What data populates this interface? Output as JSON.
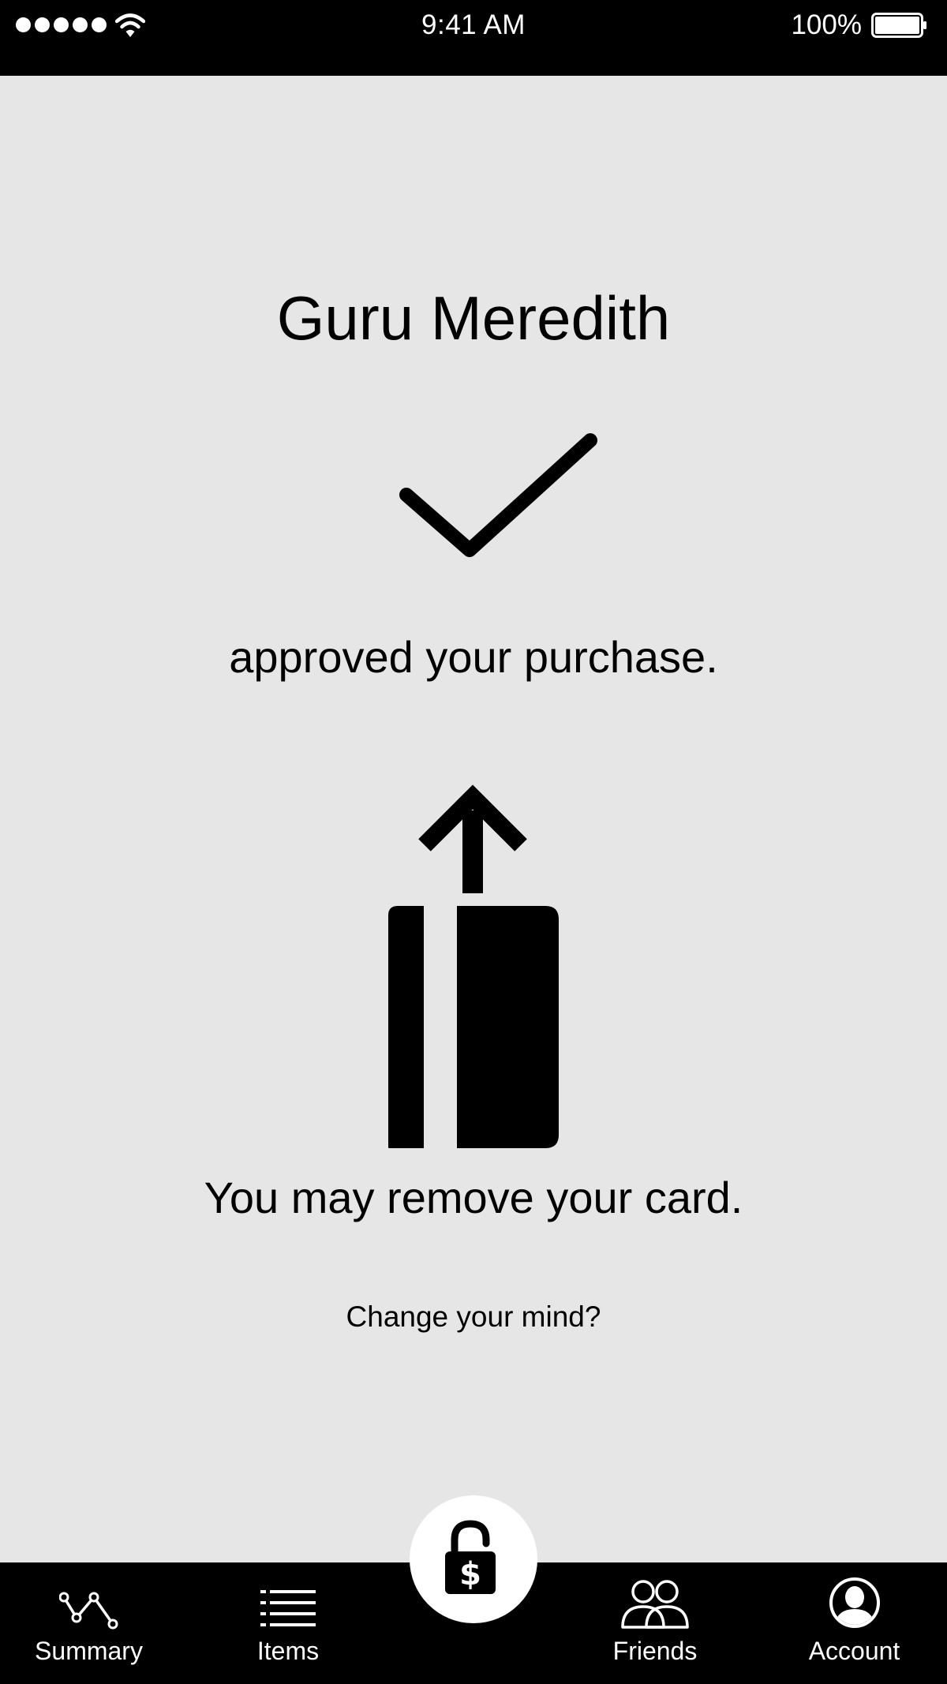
{
  "status_bar": {
    "time": "9:41 AM",
    "battery_percent": "100%",
    "signal_bars": 5,
    "signal_icon": "cellular-signal-dots",
    "wifi_icon": "wifi-icon",
    "battery_icon": "battery-full-icon"
  },
  "main": {
    "approver_name": "Guru Meredith",
    "approved_message": "approved your purchase.",
    "status_icon": "checkmark-icon",
    "card_icon": "remove-card-icon",
    "remove_card_message": "You may remove your card.",
    "change_mind_link": "Change your mind?"
  },
  "tab_bar": {
    "center_button_icon": "unlocked-padlock-dollar-icon",
    "tabs": [
      {
        "label": "Summary",
        "icon": "trend-line-icon"
      },
      {
        "label": "Items",
        "icon": "list-icon"
      },
      {
        "label": "Friends",
        "icon": "friends-icon"
      },
      {
        "label": "Account",
        "icon": "account-icon"
      }
    ]
  },
  "colors": {
    "background": "#e6e6e6",
    "bars": "#000000",
    "text": "#000000",
    "bar_text": "#ffffff"
  }
}
